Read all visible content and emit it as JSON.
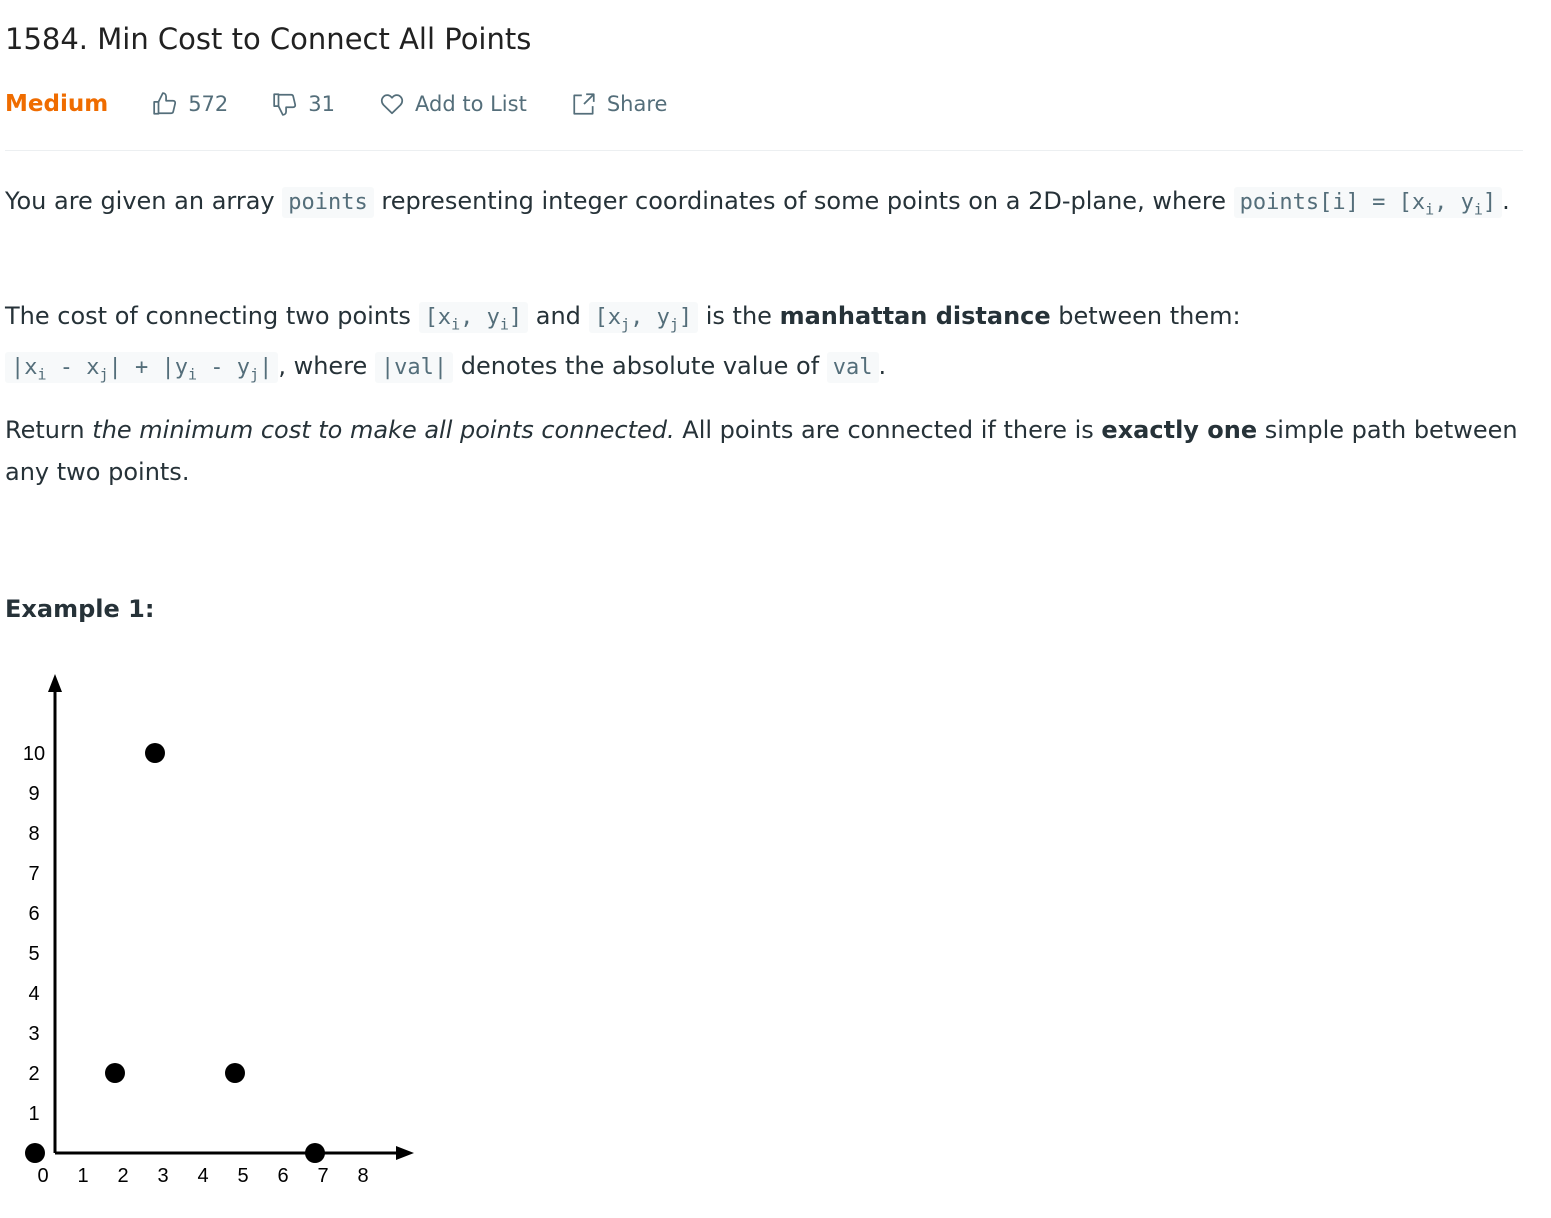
{
  "problem": {
    "title": "1584. Min Cost to Connect All Points",
    "difficulty": "Medium",
    "likes": "572",
    "dislikes": "31",
    "add_to_list": "Add to List",
    "share": "Share"
  },
  "description": {
    "p1": {
      "t1": "You are given an array ",
      "c1": "points",
      "t2": " representing integer coordinates of some points on a 2D-plane, where ",
      "c2a": "points[i] = [x",
      "c2sub1": "i",
      "c2b": ", y",
      "c2sub2": "i",
      "c2c": "]",
      "t3": "."
    },
    "p2": {
      "t1": "The cost of connecting two points ",
      "c1a": "[x",
      "c1s1": "i",
      "c1b": ", y",
      "c1s2": "i",
      "c1c": "]",
      "t2": " and ",
      "c2a": "[x",
      "c2s1": "j",
      "c2b": ", y",
      "c2s2": "j",
      "c2c": "]",
      "t3": " is the ",
      "bold": "manhattan distance",
      "t4": " between them: ",
      "c3a": "|x",
      "c3s1": "i",
      "c3b": " - x",
      "c3s2": "j",
      "c3c": "| + |y",
      "c3s3": "i",
      "c3d": " - y",
      "c3s4": "j",
      "c3e": "|",
      "t5": ", where ",
      "c4": "|val|",
      "t6": " denotes the absolute value of ",
      "c5": "val",
      "t7": "."
    },
    "p3": {
      "t1": "Return ",
      "italic": "the minimum cost to make all points connected.",
      "t2": " All points are connected if there is ",
      "bold": "exactly one",
      "t3": " simple path between any two points."
    }
  },
  "example": {
    "title": "Example 1:"
  },
  "chart_data": {
    "type": "scatter",
    "x": [
      0,
      2,
      3,
      5,
      7
    ],
    "y": [
      0,
      2,
      10,
      2,
      0
    ],
    "x_ticks": [
      "0",
      "1",
      "2",
      "3",
      "4",
      "5",
      "6",
      "7",
      "8"
    ],
    "y_ticks": [
      "1",
      "2",
      "3",
      "4",
      "5",
      "6",
      "7",
      "8",
      "9",
      "10"
    ],
    "xlim": [
      0,
      8
    ],
    "ylim": [
      0,
      10
    ],
    "grid": false
  },
  "colors": {
    "difficulty": "#ef6c00",
    "meta_text": "#546e7a",
    "code_bg": "#f7f9fa"
  },
  "icons": {
    "like": "thumbs-up-icon",
    "dislike": "thumbs-down-icon",
    "add_to_list": "heart-icon",
    "share": "share-icon"
  }
}
